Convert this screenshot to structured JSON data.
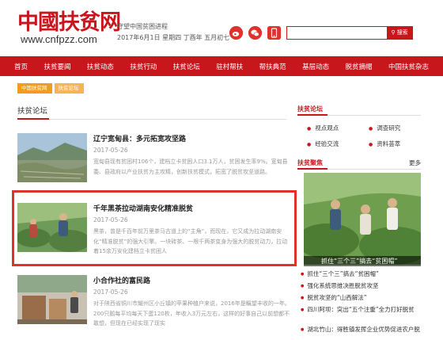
{
  "header": {
    "logo_text": "中國扶贫网",
    "logo_url": "www.cnfpzz.com",
    "slogan": "守望中国贫困进程",
    "date": "2017年6月1日 星期四 丁酉年 五月初七",
    "search": {
      "placeholder": "",
      "button": "搜索"
    },
    "icons": [
      "weibo-icon",
      "wechat-icon",
      "mobile-icon"
    ]
  },
  "nav": [
    "首页",
    "扶贫要闻",
    "扶贫动态",
    "扶贫行动",
    "扶贫论坛",
    "驻村帮扶",
    "帮扶典范",
    "基层动态",
    "脱贫摘帽",
    "中国扶贫杂志"
  ],
  "breadcrumb": [
    "中国扶贫网",
    "扶贫论坛"
  ],
  "section_title": "扶贫论坛",
  "articles": [
    {
      "title": "辽宁宽甸县：多元拓宽攻坚路",
      "date": "2017-05-26",
      "summary": "宽甸县现有贫困村106个，建档立卡贫困人口3.1万人，贫困发生率9%。宽甸县委、县政府以产业扶贫为主攻精，创新扶贫模式，拓宽了脱贫攻坚道路。"
    },
    {
      "title": "千年黑茶拉动湖南安化精准脱贫",
      "date": "2017-05-26",
      "summary": "黑茶，曾是千百年前万里茶马古道上的“主角”，而现在，它又成为拉动湖南安化“精准脱贫”的强大引擎。一块砖茶、一根千两茶变身为强大的脱贫动力，拉动着15余万安化建档立卡贫困人"
    },
    {
      "title": "小合作社的富民路",
      "date": "2017-05-26",
      "summary": "对于陕西省铜川市耀州区小丘镇的苹果种植户来说，2016年是瞩望丰收的一年。200只鹅每平均每天下蛋120枚，年收入3万元左右，这样的好事自己以前想都不敢想，但现在已经实现了现实"
    }
  ],
  "right": {
    "forum_box": {
      "title": "扶贫论坛",
      "items": [
        "视点观点",
        "调查研究",
        "经验交流",
        "资料荟萃"
      ]
    },
    "gather_box": {
      "title": "扶贫聚焦",
      "more": "更多",
      "caption": "抓住“三个三”搞去“贫困帽”"
    },
    "list": [
      "抓住“三个三”搞去“贫困帽”",
      "强化系统思维决胜脱贫攻坚",
      "脱贫攻坚的“山西解法”",
      "四川阿坝：突出“五个注重”全力打好脱贫",
      "湖北竹山：得胜镇发挥企业优势促进农户脱"
    ]
  },
  "colors": {
    "brand": "#c8161d",
    "crumb": "#f29c1f",
    "highlight": "#e0322c"
  }
}
